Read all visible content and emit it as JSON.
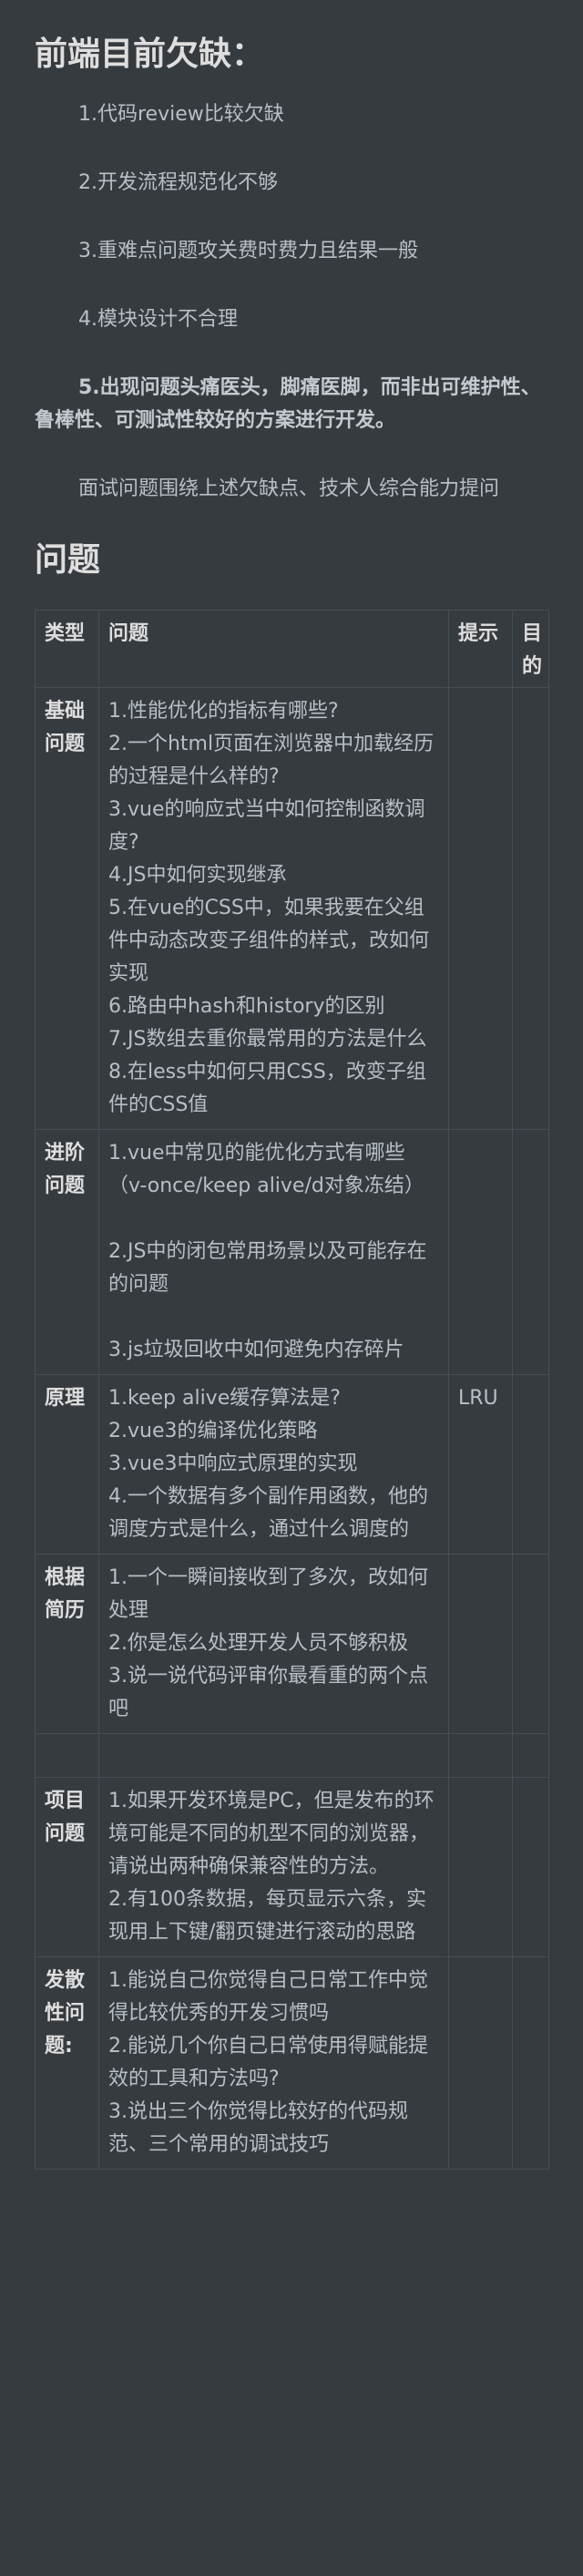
{
  "section1": {
    "title": "前端目前欠缺：",
    "items": [
      "1.代码review比较欠缺",
      "2.开发流程规范化不够",
      "3.重难点问题攻关费时费力且结果一般",
      "4.模块设计不合理",
      "5.出现问题头痛医头，脚痛医脚，而非出可维护性、鲁棒性、可测试性较好的方案进行开发。",
      "面试问题围绕上述欠缺点、技术人综合能力提问"
    ]
  },
  "section2": {
    "title": "问题",
    "headers": [
      "类型",
      "问题",
      "提示",
      "目的"
    ],
    "rows": [
      {
        "category": "基础问题",
        "questions": [
          "1.性能优化的指标有哪些?",
          "2.一个html页面在浏览器中加载经历的过程是什么样的?",
          "3.vue的响应式当中如何控制函数调度?",
          "4.JS中如何实现继承",
          "5.在vue的CSS中，如果我要在父组件中动态改变子组件的样式，改如何实现",
          "6.路由中hash和history的区别",
          "7.JS数组去重你最常用的方法是什么",
          "8.在less中如何只用CSS，改变子组件的CSS值"
        ],
        "hint": "",
        "purpose": ""
      },
      {
        "category": "进阶问题",
        "questions": [
          "1.vue中常见的能优化方式有哪些（v-once/keep alive/d对象冻结）",
          "",
          "2.JS中的闭包常用场景以及可能存在的问题",
          "",
          "3.js垃圾回收中如何避免内存碎片"
        ],
        "hint": "",
        "purpose": ""
      },
      {
        "category": "原理",
        "questions": [
          "1.keep alive缓存算法是?",
          "2.vue3的编译优化策略",
          "3.vue3中响应式原理的实现",
          "4.一个数据有多个副作用函数，他的调度方式是什么，通过什么调度的"
        ],
        "hint": "LRU",
        "purpose": ""
      },
      {
        "category": "根据简历",
        "questions": [
          "1.一个一瞬间接收到了多次，改如何处理",
          "2.你是怎么处理开发人员不够积极",
          "3.说一说代码评审你最看重的两个点吧"
        ],
        "hint": "",
        "purpose": ""
      },
      {
        "category": "",
        "questions": [],
        "hint": "",
        "purpose": ""
      },
      {
        "category": "项目问题",
        "questions": [
          "1.如果开发环境是PC，但是发布的环境可能是不同的机型不同的浏览器，请说出两种确保兼容性的方法。",
          "2.有100条数据，每页显示六条，实现用上下键/翻页键进行滚动的思路"
        ],
        "hint": "",
        "purpose": ""
      },
      {
        "category": "发散性问题:",
        "questions": [
          "1.能说自己你觉得自己日常工作中觉得比较优秀的开发习惯吗",
          "2.能说几个你自己日常使用得赋能提效的工具和方法吗?",
          "3.说出三个你觉得比较好的代码规范、三个常用的调试技巧"
        ],
        "hint": "",
        "purpose": ""
      }
    ]
  }
}
